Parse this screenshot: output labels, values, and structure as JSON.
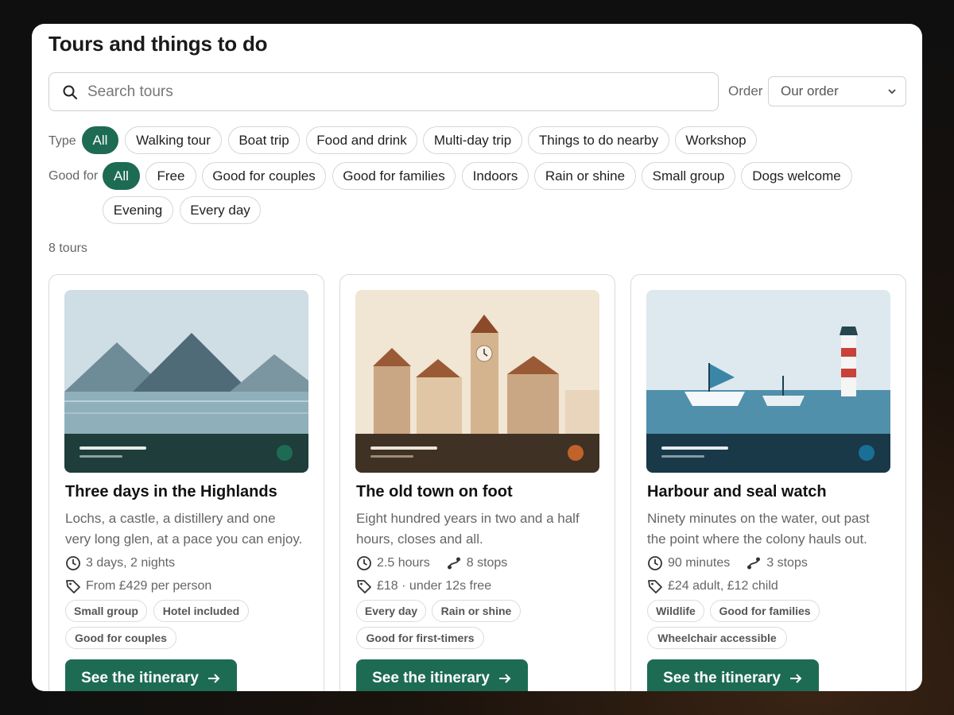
{
  "page": {
    "title": "Tours and things to do"
  },
  "search": {
    "placeholder": "Search tours"
  },
  "order": {
    "label": "Order",
    "selected": "Our order"
  },
  "filters": {
    "type": {
      "label": "Type",
      "options": [
        "All",
        "Walking tour",
        "Boat trip",
        "Food and drink",
        "Multi-day trip",
        "Things to do nearby",
        "Workshop"
      ]
    },
    "good_for": {
      "label": "Good for",
      "options": [
        "All",
        "Free",
        "Good for couples",
        "Good for families",
        "Indoors",
        "Rain or shine",
        "Small group",
        "Dogs welcome",
        "Evening",
        "Every day"
      ]
    }
  },
  "results": {
    "count_text": "8 tours"
  },
  "cards": [
    {
      "title": "Three days in the Highlands",
      "description": "Lochs, a castle, a distillery and one very long glen, at a pace you can enjoy.",
      "duration": "3 days, 2 nights",
      "stops": "",
      "price": "From £429 per person",
      "tags": [
        "Small group",
        "Hotel included",
        "Good for couples"
      ],
      "cta": "See the itinerary",
      "accent": "#1e6b54"
    },
    {
      "title": "The old town on foot",
      "description": "Eight hundred years in two and a half hours, closes and all.",
      "duration": "2.5 hours",
      "stops": "8 stops",
      "price": "£18 · under 12s free",
      "tags": [
        "Every day",
        "Rain or shine",
        "Good for first-timers"
      ],
      "cta": "See the itinerary",
      "accent": "#c0622a"
    },
    {
      "title": "Harbour and seal watch",
      "description": "Ninety minutes on the water, out past the point where the colony hauls out.",
      "duration": "90 minutes",
      "stops": "3 stops",
      "price": "£24 adult, £12 child",
      "tags": [
        "Wildlife",
        "Good for families",
        "Wheelchair accessible"
      ],
      "cta": "See the itinerary",
      "accent": "#1a6f99"
    }
  ],
  "icons": {
    "search": "search-icon",
    "clock": "clock-icon",
    "route": "route-icon",
    "tag": "price-tag-icon",
    "arrow": "arrow-right-icon",
    "chevron": "chevron-down-icon"
  },
  "colors": {
    "primary": "#1e6b54"
  }
}
